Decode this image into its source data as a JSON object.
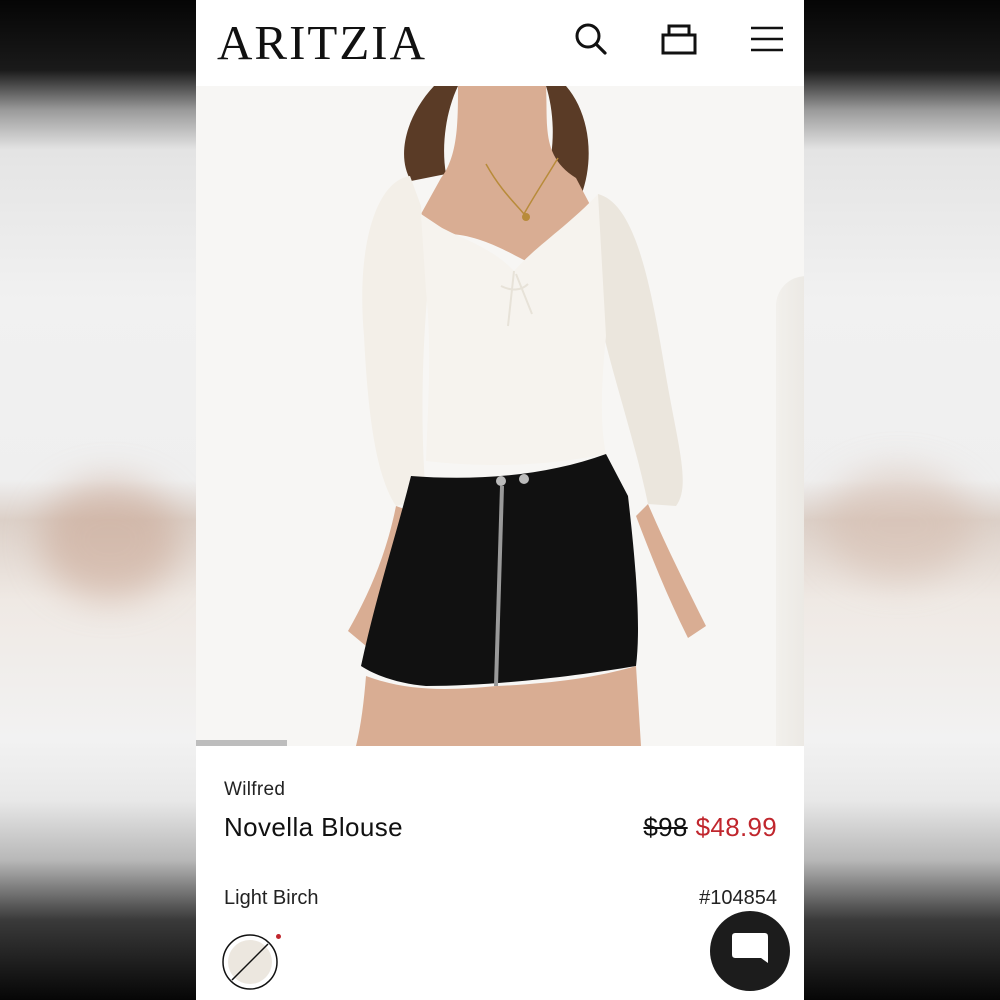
{
  "header": {
    "logo": "ARITZIA"
  },
  "icons": {
    "search": "search-icon",
    "bag": "bag-icon",
    "menu": "menu-icon",
    "chat": "chat-icon"
  },
  "carousel": {
    "progress": 0.15
  },
  "product": {
    "brand": "Wilfred",
    "name": "Novella Blouse",
    "price_original": "$98",
    "price_sale": "$48.99",
    "color_name": "Light Birch",
    "sku": "#104854"
  },
  "colors": {
    "sale": "#c0262d",
    "text": "#111111"
  }
}
